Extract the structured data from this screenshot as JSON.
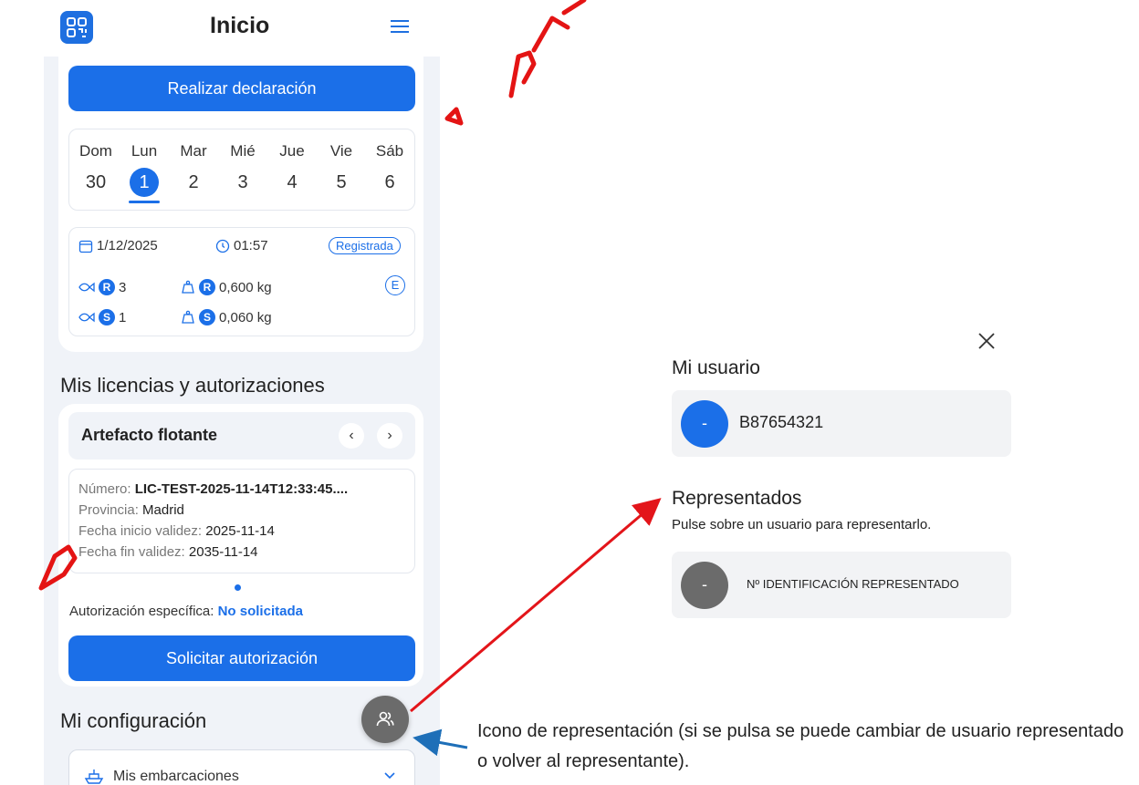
{
  "header": {
    "title": "Inicio"
  },
  "actions": {
    "declaracion": "Realizar declaración",
    "solicitar": "Solicitar autorización"
  },
  "week": {
    "days": [
      {
        "name": "Dom",
        "num": "30"
      },
      {
        "name": "Lun",
        "num": "1"
      },
      {
        "name": "Mar",
        "num": "2"
      },
      {
        "name": "Mié",
        "num": "3"
      },
      {
        "name": "Jue",
        "num": "4"
      },
      {
        "name": "Vie",
        "num": "5"
      },
      {
        "name": "Sáb",
        "num": "6"
      }
    ],
    "selected_day": "1"
  },
  "record": {
    "date": "1/12/2025",
    "time": "01:57",
    "status": "Registrada",
    "e_badge": "E",
    "rows": [
      {
        "badge": "R",
        "count": "3",
        "weight": "0,600 kg"
      },
      {
        "badge": "S",
        "count": "1",
        "weight": "0,060 kg"
      }
    ]
  },
  "licencias": {
    "section_title": "Mis licencias y autorizaciones",
    "name": "Artefacto flotante",
    "prev": "‹",
    "next": "›",
    "numero_label": "Número:",
    "numero_value": "LIC-TEST-2025-11-14T12:33:45....",
    "provincia_label": "Provincia:",
    "provincia_value": "Madrid",
    "inicio_label": "Fecha inicio validez:",
    "inicio_value": "2025-11-14",
    "fin_label": "Fecha fin validez:",
    "fin_value": "2035-11-14",
    "autor_label": "Autorización específica:",
    "autor_value": "No solicitada"
  },
  "config": {
    "section_title": "Mi configuración",
    "embarcaciones": "Mis embarcaciones"
  },
  "right": {
    "mi_usuario": "Mi usuario",
    "user_avatar": "-",
    "user_id": "B87654321",
    "representados": "Representados",
    "hint": "Pulse sobre un usuario para representarlo.",
    "rep_avatar": "-",
    "rep_id": "Nº IDENTIFICACIÓN REPRESENTADO",
    "close": "×"
  },
  "caption": "Icono de representación (si se pulsa se puede cambiar de usuario representado o volver al representante).",
  "colors": {
    "primary": "#1b6fe8",
    "annotation_red": "#e3151a",
    "annotation_blue": "#1e6fb8",
    "watermark": "#e41414"
  },
  "icons": [
    "app-logo-icon",
    "menu-icon",
    "calendar-icon",
    "clock-icon",
    "fish-icon",
    "weight-icon",
    "represent-users-icon",
    "ship-icon",
    "chevron-down-icon",
    "close-icon"
  ]
}
